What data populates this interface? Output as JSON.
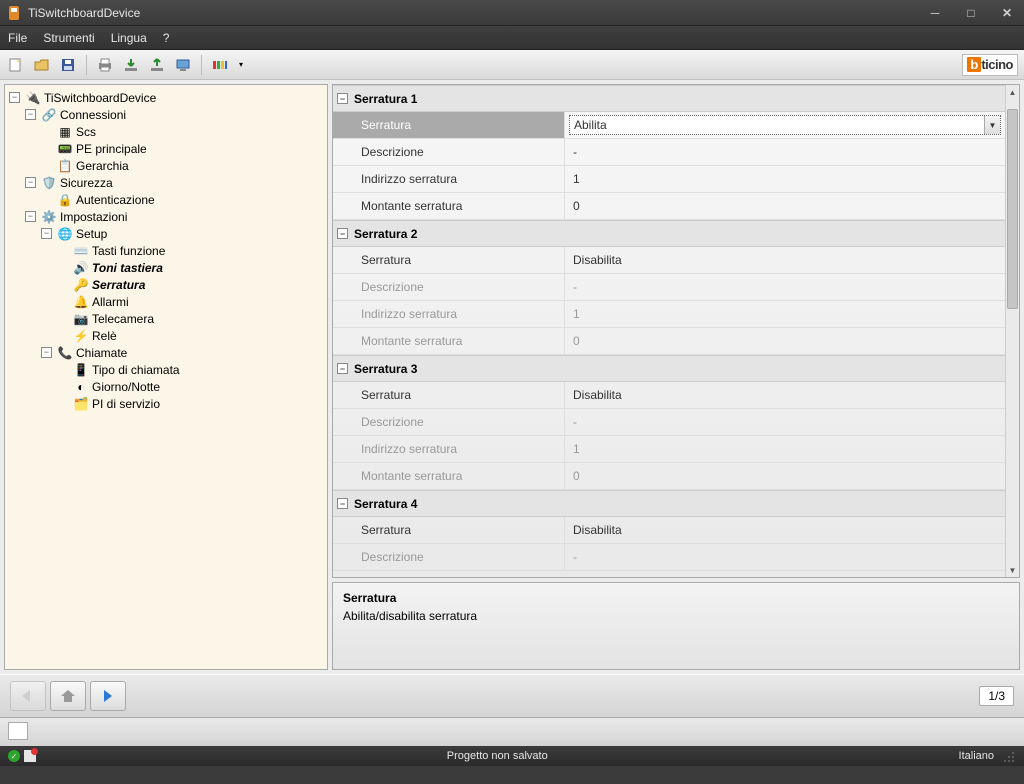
{
  "window": {
    "title": "TiSwitchboardDevice"
  },
  "menu": {
    "file": "File",
    "strumenti": "Strumenti",
    "lingua": "Lingua",
    "help": "?"
  },
  "logo": {
    "prefix": "b",
    "suffix": "ticino"
  },
  "tree": {
    "root": "TiSwitchboardDevice",
    "connessioni": "Connessioni",
    "scs": "Scs",
    "pe": "PE principale",
    "gerarchia": "Gerarchia",
    "sicurezza": "Sicurezza",
    "autenticazione": "Autenticazione",
    "impostazioni": "Impostazioni",
    "setup": "Setup",
    "tasti": "Tasti funzione",
    "toni": "Toni tastiera",
    "serratura": "Serratura",
    "allarmi": "Allarmi",
    "telecamera": "Telecamera",
    "rele": "Relè",
    "chiamate": "Chiamate",
    "tipo": "Tipo di chiamata",
    "gn": "Giorno/Notte",
    "pi": "PI di servizio"
  },
  "groups": [
    {
      "title": "Serratura 1",
      "enabled": true,
      "selected": true,
      "rows": [
        {
          "label": "Serratura",
          "value": "Abilita",
          "combo": true
        },
        {
          "label": "Descrizione",
          "value": "-"
        },
        {
          "label": "Indirizzo serratura",
          "value": "1"
        },
        {
          "label": "Montante serratura",
          "value": "0"
        }
      ]
    },
    {
      "title": "Serratura 2",
      "enabled": false,
      "rows": [
        {
          "label": "Serratura",
          "value": "Disabilita",
          "forceEnabled": true
        },
        {
          "label": "Descrizione",
          "value": "-"
        },
        {
          "label": "Indirizzo serratura",
          "value": "1"
        },
        {
          "label": "Montante serratura",
          "value": "0"
        }
      ]
    },
    {
      "title": "Serratura 3",
      "enabled": false,
      "rows": [
        {
          "label": "Serratura",
          "value": "Disabilita",
          "forceEnabled": true
        },
        {
          "label": "Descrizione",
          "value": "-"
        },
        {
          "label": "Indirizzo serratura",
          "value": "1"
        },
        {
          "label": "Montante serratura",
          "value": "0"
        }
      ]
    },
    {
      "title": "Serratura 4",
      "enabled": false,
      "rows": [
        {
          "label": "Serratura",
          "value": "Disabilita",
          "forceEnabled": true
        },
        {
          "label": "Descrizione",
          "value": "-"
        }
      ]
    }
  ],
  "help": {
    "title": "Serratura",
    "text": "Abilita/disabilita serratura"
  },
  "nav": {
    "page": "1/3"
  },
  "status": {
    "center": "Progetto non salvato",
    "lang": "Italiano"
  }
}
